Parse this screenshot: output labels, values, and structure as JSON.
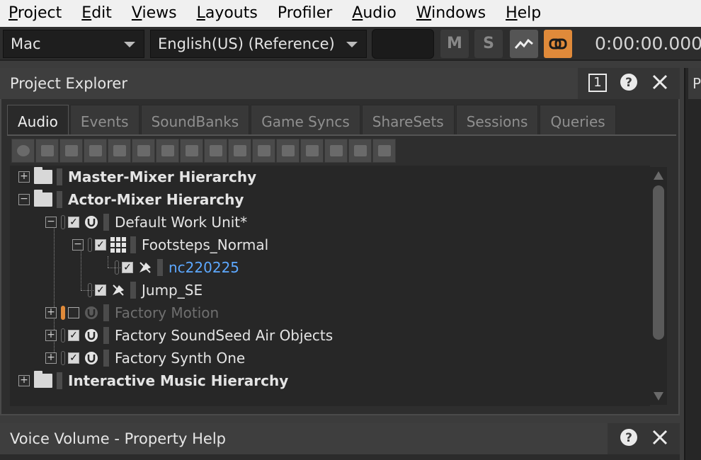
{
  "menu": [
    {
      "label": "Project",
      "key": "P",
      "rest": "roject"
    },
    {
      "label": "Edit",
      "key": "E",
      "rest": "dit"
    },
    {
      "label": "Views",
      "key": "V",
      "rest": "iews"
    },
    {
      "label": "Layouts",
      "key": "L",
      "rest": "ayouts"
    },
    {
      "label": "Profiler",
      "key": "",
      "rest": "Profiler"
    },
    {
      "label": "Audio",
      "key": "A",
      "rest": "udio"
    },
    {
      "label": "Windows",
      "key": "W",
      "rest": "indows"
    },
    {
      "label": "Help",
      "key": "H",
      "rest": "elp"
    }
  ],
  "toolbar": {
    "platform": "Mac",
    "language": "English(US) (Reference)",
    "mute_label": "M",
    "solo_label": "S",
    "timecode": "0:00:00.000",
    "link_color": "#e08a3a"
  },
  "project_explorer": {
    "title": "Project Explorer",
    "window_number": "1",
    "help_icon": "help-icon",
    "close_icon": "close-icon",
    "tabs": [
      {
        "label": "Audio",
        "active": true
      },
      {
        "label": "Events",
        "active": false
      },
      {
        "label": "SoundBanks",
        "active": false
      },
      {
        "label": "Game Syncs",
        "active": false
      },
      {
        "label": "ShareSets",
        "active": false
      },
      {
        "label": "Sessions",
        "active": false
      },
      {
        "label": "Queries",
        "active": false
      }
    ],
    "tree": {
      "master": "Master-Mixer Hierarchy",
      "actor": "Actor-Mixer Hierarchy",
      "work_unit": "Default Work Unit*",
      "footsteps": "Footsteps_Normal",
      "nc": "nc220225",
      "jump": "Jump_SE",
      "factory_motion": "Factory Motion",
      "factory_air": "Factory SoundSeed Air Objects",
      "factory_synth": "Factory Synth One",
      "interactive": "Interactive Music Hierarchy"
    }
  },
  "right_tab_label": "P",
  "bottom_panel": {
    "title": "Voice Volume - Property Help"
  }
}
